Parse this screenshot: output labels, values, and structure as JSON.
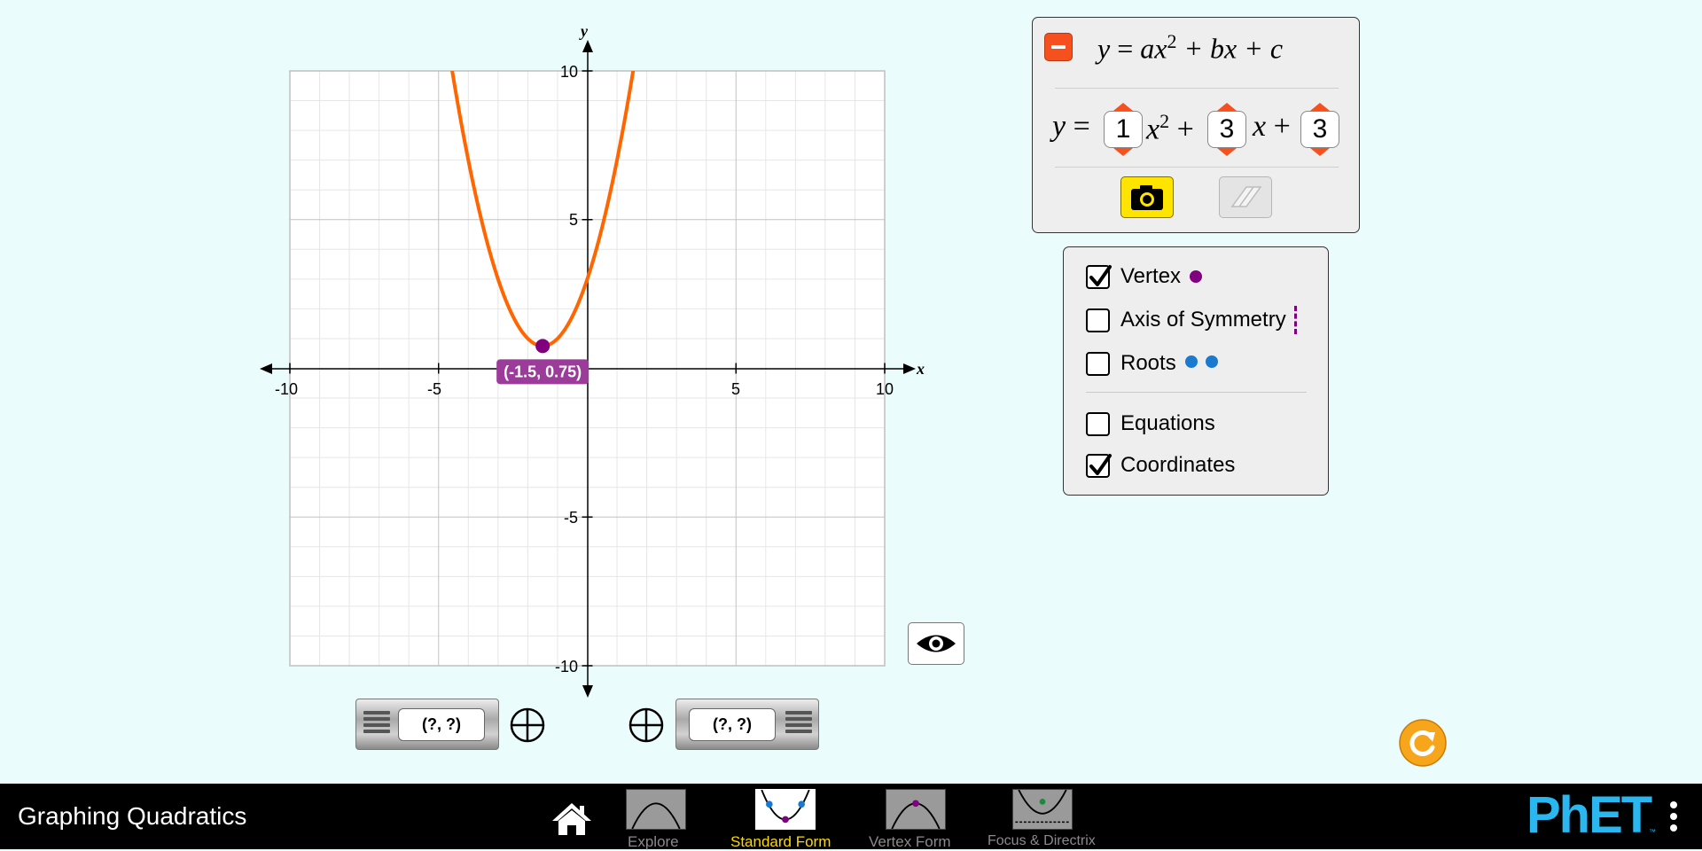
{
  "graph": {
    "x_axis_label": "x",
    "y_axis_label": "y",
    "x_ticks": [
      "-10",
      "-5",
      "5",
      "10"
    ],
    "y_ticks": [
      "10",
      "5",
      "-5",
      "-10"
    ],
    "x_range": [
      -10,
      10
    ],
    "y_range": [
      -10,
      10
    ],
    "curve_color": "#ff6600",
    "curve_coefficients": {
      "a": 1,
      "b": 3,
      "c": 3
    },
    "vertex_point": {
      "x": -1.5,
      "y": 0.75,
      "color": "#800080"
    },
    "vertex_label": "(-1.5, 0.75)",
    "vertex_label_color": "#9b3c9b"
  },
  "equation_panel": {
    "general_form": {
      "y": "y",
      "eq": "=",
      "ax": "ax",
      "exp": "2",
      "bx": "+ bx",
      "c": "+ c"
    },
    "interactive": {
      "y": "y",
      "eq": "=",
      "x2": "x",
      "exp": "2",
      "plus1": "+",
      "x": "x",
      "plus2": "+"
    },
    "a_value": "1",
    "b_value": "3",
    "c_value": "3",
    "accent_color": "#f5501e",
    "camera_button_color": "#ffe400",
    "icons": [
      "minus-icon",
      "camera-icon",
      "eraser-icon"
    ]
  },
  "checkboxes": {
    "vertex": {
      "label": "Vertex",
      "checked": true
    },
    "axis_of_symmetry": {
      "label": "Axis of Symmetry",
      "checked": false
    },
    "roots": {
      "label": "Roots",
      "checked": false
    },
    "equations": {
      "label": "Equations",
      "checked": false
    },
    "coordinates": {
      "label": "Coordinates",
      "checked": true
    },
    "roots_color": "#1a7ad0",
    "vertex_color": "#800080"
  },
  "point_tools": {
    "left": {
      "readout": "(?, ?)"
    },
    "right": {
      "readout": "(?, ?)"
    }
  },
  "navbar": {
    "title": "Graphing Quadratics",
    "tabs": [
      {
        "label": "Explore",
        "active": false
      },
      {
        "label": "Standard Form",
        "active": true
      },
      {
        "label": "Vertex Form",
        "active": false
      },
      {
        "label": "Focus & Directrix",
        "active": false
      }
    ],
    "logo": "PhET",
    "active_tab_color": "#ffd800",
    "logo_color": "#2ab6ef"
  }
}
